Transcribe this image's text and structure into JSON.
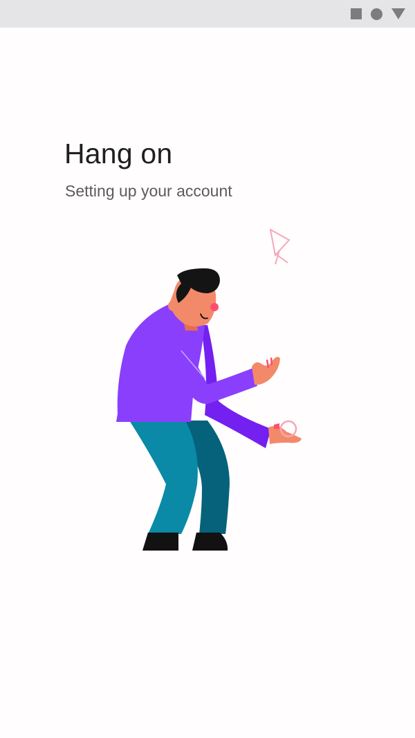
{
  "status_bar": {
    "icons": [
      "stop-square-icon",
      "record-circle-icon",
      "signal-triangle-icon"
    ],
    "icon_color": "#7d7d7f",
    "background": "#e5e4e6"
  },
  "main": {
    "title": "Hang on",
    "subtitle": "Setting up your account"
  },
  "illustration": {
    "subject": "juggler-figure",
    "colors": {
      "shirt": "#8a3ffc",
      "shirt_shadow": "#7420f0",
      "pants": "#0a8aa6",
      "pants_shadow": "#05627a",
      "skin": "#f28a6a",
      "hair": "#141414",
      "accent": "#ff4f6e"
    }
  }
}
